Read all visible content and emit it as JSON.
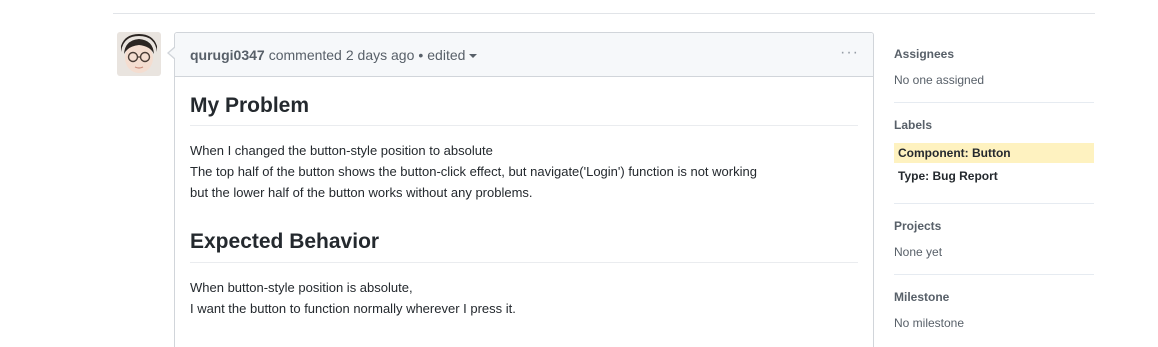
{
  "comment": {
    "author": "qurugi0347",
    "action": "commented",
    "time": "2 days ago",
    "separator": "•",
    "edited": "edited",
    "more": "···",
    "sections": [
      {
        "heading": "My Problem",
        "lines": [
          "When I changed the button-style position to absolute",
          "The top half of the button shows the button-click effect, but navigate('Login') function is not working",
          "but the lower half of the button works without any problems."
        ]
      },
      {
        "heading": "Expected Behavior",
        "lines": [
          "When button-style position is absolute,",
          "I want the button to function normally wherever I press it."
        ]
      }
    ]
  },
  "sidebar": {
    "assignees": {
      "title": "Assignees",
      "value": "No one assigned"
    },
    "labels": {
      "title": "Labels",
      "items": [
        {
          "text": "Component: Button",
          "color": "#fef2c0"
        },
        {
          "text": "Type: Bug Report",
          "color": "#ffffff"
        }
      ]
    },
    "projects": {
      "title": "Projects",
      "value": "None yet"
    },
    "milestone": {
      "title": "Milestone",
      "value": "No milestone"
    }
  }
}
